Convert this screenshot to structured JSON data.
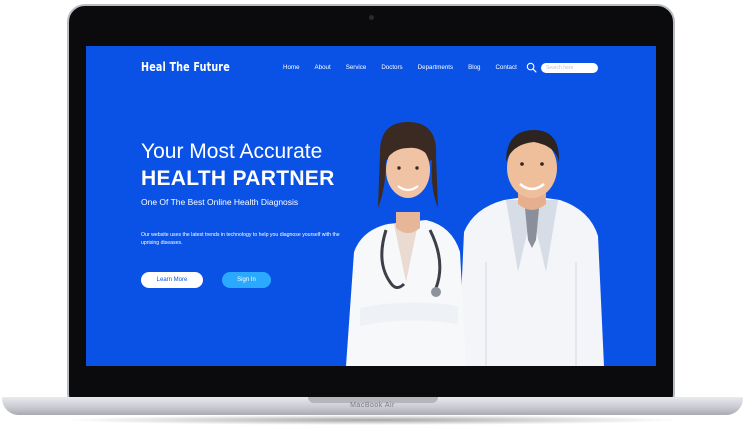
{
  "device": {
    "label": "MacBook Air"
  },
  "header": {
    "logo": "Heal The Future",
    "nav": [
      "Home",
      "About",
      "Service",
      "Doctors",
      "Departments",
      "Blog",
      "Contact"
    ],
    "search_icon": "search-icon",
    "search_placeholder": "Search here"
  },
  "hero": {
    "line1": "Your Most Accurate",
    "line2": "HEALTH PARTNER",
    "subtitle": "One Of The Best Online Health Diagnosis",
    "description": "Our website uses the latest trends in technology to help you diagnose yourself with the uprising diseases.",
    "learn_more": "Learn More",
    "sign_in": "Sign In"
  },
  "colors": {
    "screen_bg": "#0a52e6",
    "sign_in_button": "#2aa9ff",
    "learn_more_button": "#ffffff",
    "bezel": "#0b0b0d"
  }
}
